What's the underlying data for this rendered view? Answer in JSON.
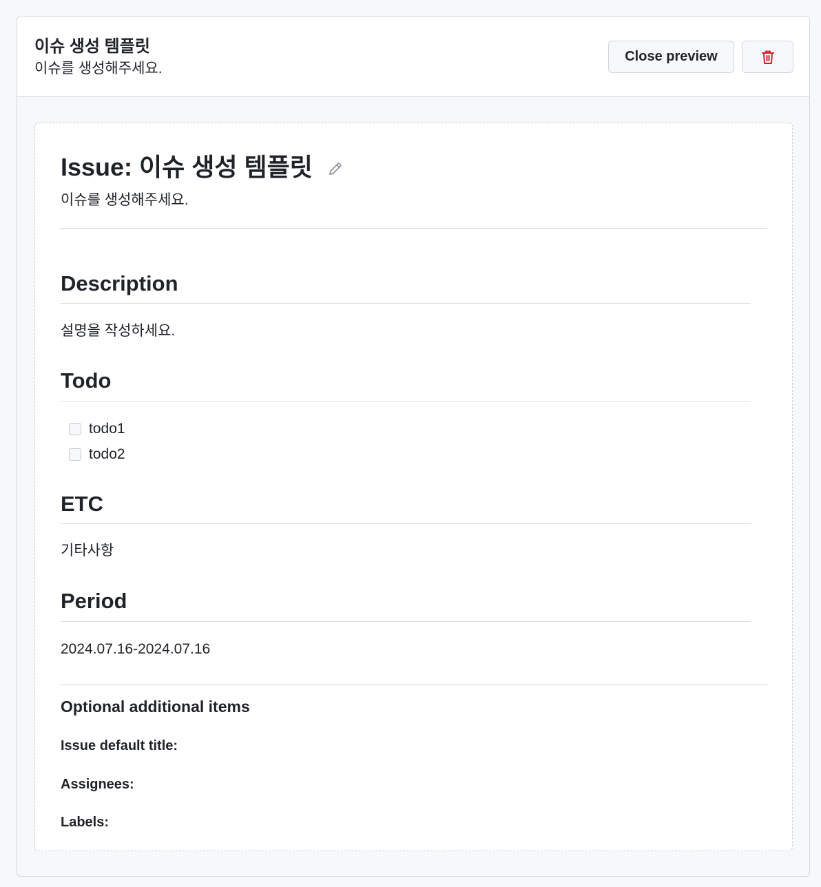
{
  "header": {
    "title": "이슈 생성 템플릿",
    "description": "이슈를 생성해주세요.",
    "close_preview_label": "Close preview",
    "delete_icon": "trash-icon",
    "delete_color": "#cf222e"
  },
  "preview": {
    "issue_title": "Issue: 이슈 생성 템플릿",
    "edit_icon": "pencil-icon",
    "issue_description": "이슈를 생성해주세요.",
    "sections": {
      "description": {
        "heading": "Description",
        "body": "설명을 작성하세요."
      },
      "todo": {
        "heading": "Todo",
        "items": [
          {
            "label": "todo1",
            "checked": false
          },
          {
            "label": "todo2",
            "checked": false
          }
        ]
      },
      "etc": {
        "heading": "ETC",
        "body": "기타사항"
      },
      "period": {
        "heading": "Period",
        "body": "2024.07.16-2024.07.16"
      }
    },
    "optional": {
      "heading": "Optional additional items",
      "default_title_label": "Issue default title:",
      "assignees_label": "Assignees:",
      "labels_label": "Labels:"
    }
  }
}
